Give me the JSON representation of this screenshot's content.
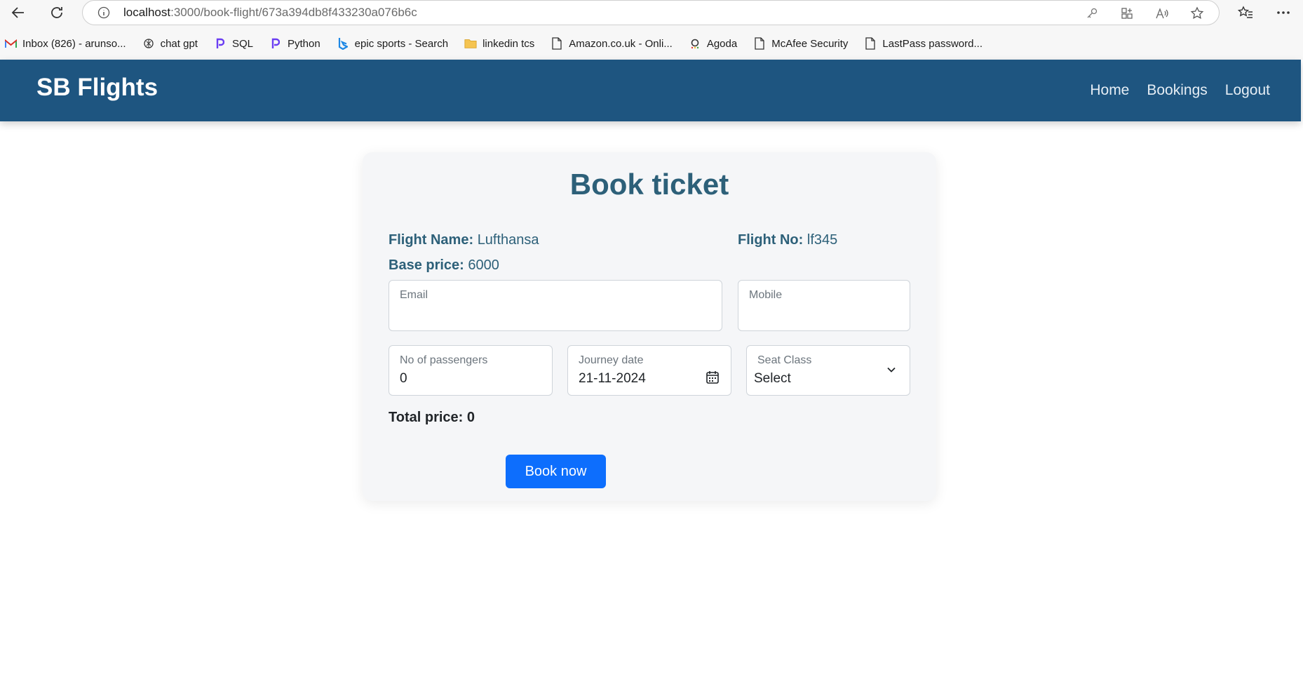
{
  "browser": {
    "url_host": "localhost",
    "url_path": ":3000/book-flight/673a394db8f433230a076b6c",
    "bookmarks": [
      {
        "label": "Inbox (826) - arunso...",
        "icon": "gmail-icon"
      },
      {
        "label": "chat gpt",
        "icon": "chatgpt-icon"
      },
      {
        "label": "SQL",
        "icon": "p-logo-icon"
      },
      {
        "label": "Python",
        "icon": "p-logo-icon"
      },
      {
        "label": "epic sports - Search",
        "icon": "bing-icon"
      },
      {
        "label": "linkedin tcs",
        "icon": "folder-icon"
      },
      {
        "label": "Amazon.co.uk - Onli...",
        "icon": "page-icon"
      },
      {
        "label": "Agoda",
        "icon": "agoda-icon"
      },
      {
        "label": "McAfee Security",
        "icon": "page-icon"
      },
      {
        "label": "LastPass password...",
        "icon": "page-icon"
      }
    ]
  },
  "navbar": {
    "brand": "SB Flights",
    "links": [
      "Home",
      "Bookings",
      "Logout"
    ]
  },
  "card": {
    "title": "Book ticket",
    "flight_name_label": "Flight Name:",
    "flight_name_value": "Lufthansa",
    "flight_no_label": "Flight No:",
    "flight_no_value": "lf345",
    "base_price_label": "Base price:",
    "base_price_value": "6000",
    "email_label": "Email",
    "mobile_label": "Mobile",
    "passengers_label": "No of passengers",
    "passengers_value": "0",
    "journey_label": "Journey date",
    "journey_value": "21-11-2024",
    "seat_label": "Seat Class",
    "seat_value": "Select",
    "total_label": "Total price:",
    "total_value": "0",
    "book_button": "Book now"
  },
  "colors": {
    "navbar": "#1e5580",
    "title": "#2d6079",
    "button": "#0d6efd"
  }
}
